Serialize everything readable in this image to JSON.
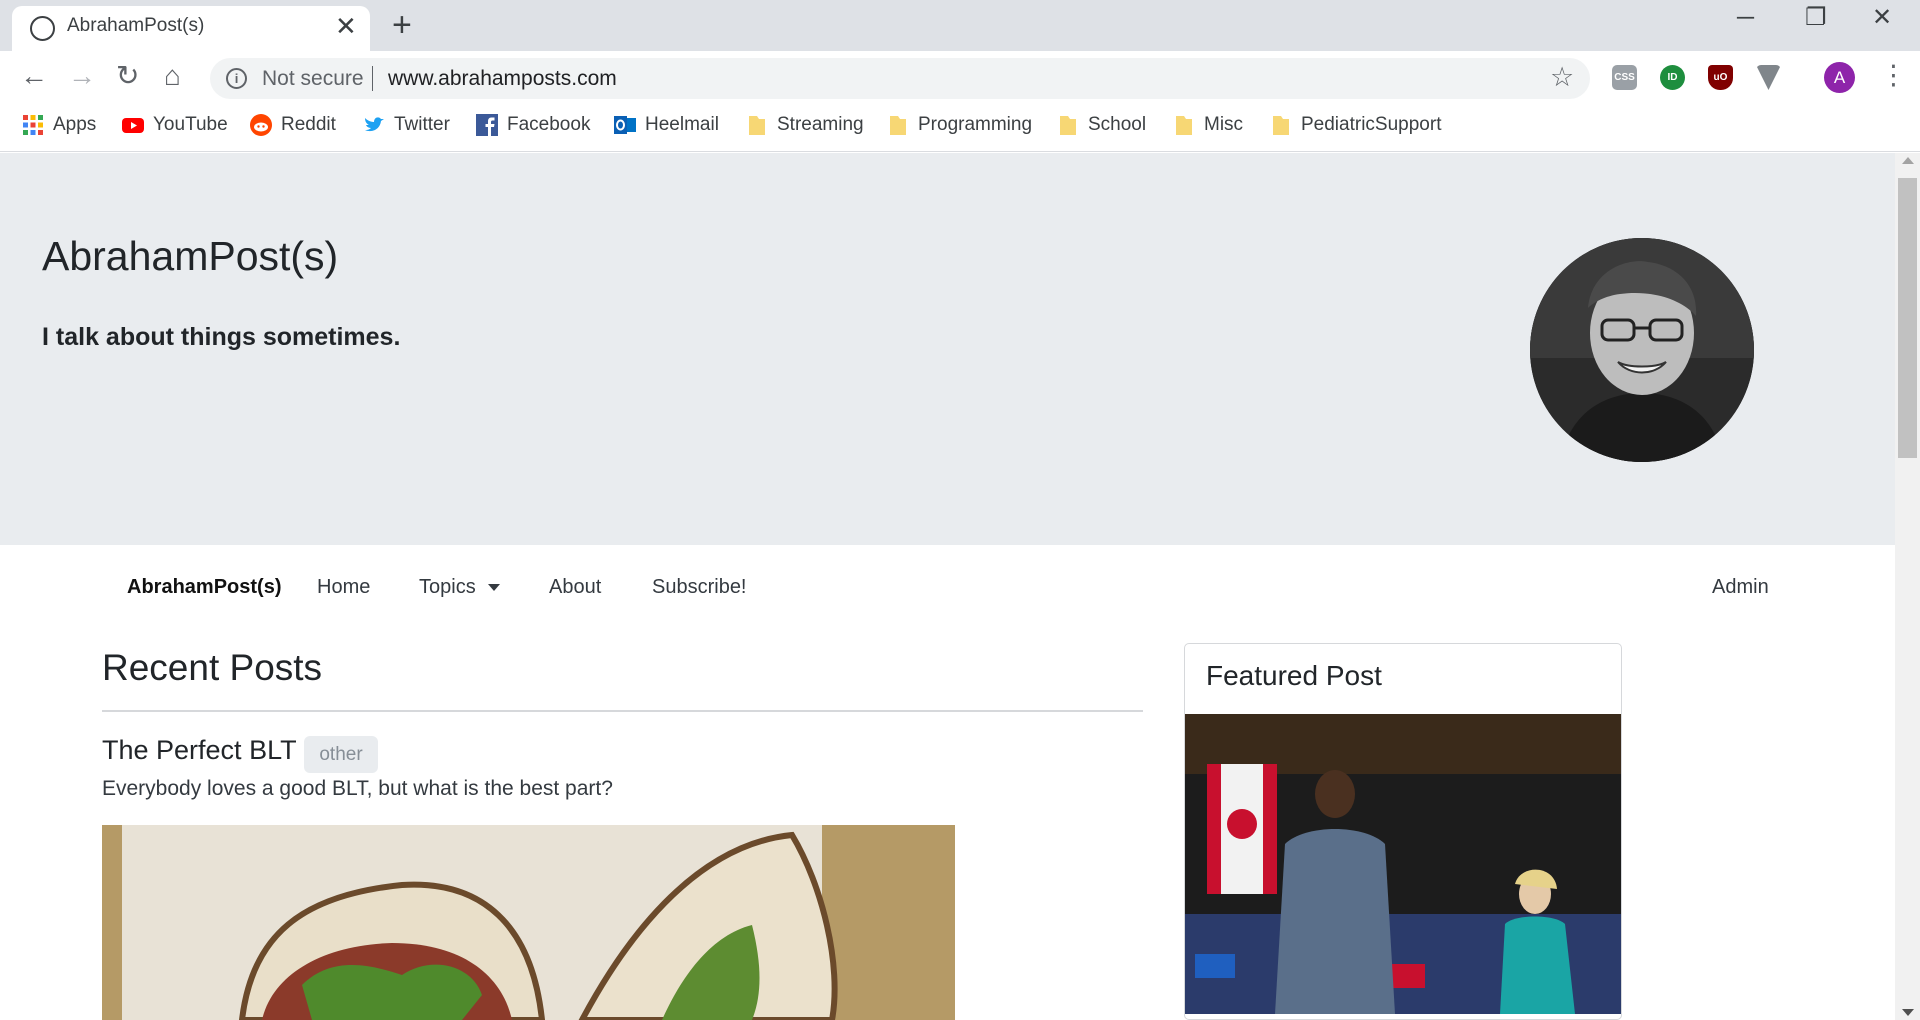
{
  "browser": {
    "tab": {
      "title": "AbrahamPost(s)",
      "close": "✕"
    },
    "new_tab": "+",
    "window_controls": {
      "minimize": "─",
      "restore": "❐",
      "close": "✕"
    },
    "nav": {
      "back": "←",
      "forward": "→",
      "reload": "↻",
      "home": "⌂"
    },
    "security_label": "Not secure",
    "url": "www.abrahamposts.com",
    "bookmark_star": "☆",
    "profile_initial": "A",
    "menu": "⋮"
  },
  "bookmarks": [
    {
      "label": "Apps",
      "icon": "apps-grid-icon"
    },
    {
      "label": "YouTube",
      "icon": "youtube-icon",
      "color": "#ff0000"
    },
    {
      "label": "Reddit",
      "icon": "reddit-icon",
      "color": "#ff4500"
    },
    {
      "label": "Twitter",
      "icon": "twitter-icon",
      "color": "#1da1f2"
    },
    {
      "label": "Facebook",
      "icon": "facebook-icon",
      "color": "#3b5998"
    },
    {
      "label": "Heelmail",
      "icon": "outlook-icon",
      "color": "#0072c6"
    },
    {
      "label": "Streaming",
      "icon": "folder-icon",
      "color": "#f7d774"
    },
    {
      "label": "Programming",
      "icon": "folder-icon",
      "color": "#f7d774"
    },
    {
      "label": "School",
      "icon": "folder-icon",
      "color": "#f7d774"
    },
    {
      "label": "Misc",
      "icon": "folder-icon",
      "color": "#f7d774"
    },
    {
      "label": "PediatricSupport",
      "icon": "folder-icon",
      "color": "#f7d774"
    }
  ],
  "site": {
    "title": "AbrahamPost(s)",
    "tagline": "I talk about things sometimes.",
    "nav": {
      "brand": "AbrahamPost(s)",
      "home": "Home",
      "topics": "Topics",
      "about": "About",
      "subscribe": "Subscribe!",
      "admin": "Admin"
    },
    "recent": {
      "heading": "Recent Posts",
      "posts": [
        {
          "title": "The Perfect BLT",
          "tag": "other",
          "excerpt": "Everybody loves a good BLT, but what is the best part?"
        }
      ]
    },
    "featured": {
      "heading": "Featured Post"
    }
  }
}
